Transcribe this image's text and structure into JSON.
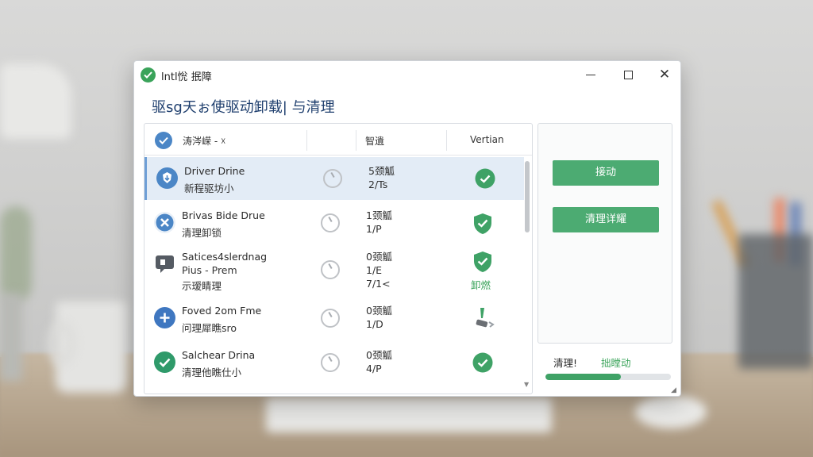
{
  "window": {
    "title": "lntl恱 抿障",
    "heading": "驱sg天ぉ使驱动卸载| 与清理"
  },
  "list": {
    "headers": {
      "name": "涛涔嵘 - ☓",
      "management": "智遺",
      "version": "Vertian"
    },
    "rows": [
      {
        "name": "Driver Drine",
        "sub": [
          "新程驱坊小"
        ],
        "size": [
          "5颈觚",
          "2/Ts"
        ],
        "status": "check-circle",
        "status_label": "",
        "icon": "shield-arrow-icon",
        "icon_color": "#4b86c6",
        "selected": true
      },
      {
        "name": "Brivas Bide Drue",
        "sub": [
          "清理卸锁"
        ],
        "size": [
          "1颈觚",
          "1/P"
        ],
        "status": "check-shield",
        "status_label": "",
        "icon": "cross-badge-icon",
        "icon_color": "#4b86c6",
        "selected": false
      },
      {
        "name": "Satices4slerdnag",
        "sub": [
          "Pius - Prem",
          "示瑷睛理"
        ],
        "size": [
          "0颈觚",
          "1/E",
          "7/1<"
        ],
        "status": "check-shield",
        "status_label": "卸燃",
        "icon": "chat-bubble-icon",
        "icon_color": "#555b63",
        "selected": false
      },
      {
        "name": "Foved 2om Fme",
        "sub": [
          "问理犀瞧sro"
        ],
        "size": [
          "0颈觚",
          "1/D"
        ],
        "status": "uninstall-tool",
        "status_label": "",
        "icon": "plus-circle-icon",
        "icon_color": "#3f77c0",
        "selected": false
      },
      {
        "name": "Salchear Drina",
        "sub": [
          "清理他瞧仕小"
        ],
        "size": [
          "0颈觚",
          "4/P"
        ],
        "status": "check-circle",
        "status_label": "",
        "icon": "check-badge-icon",
        "icon_color": "#2f9a6a",
        "selected": false
      }
    ]
  },
  "actions": {
    "move_label": "接动",
    "clean_label": "清理详耀"
  },
  "status": {
    "label": "清理!",
    "value": "拙瞠动",
    "progress": 0.6
  },
  "colors": {
    "accent_green": "#4cab72",
    "accent_blue": "#4b86c6",
    "heading": "#1f3f6e"
  }
}
